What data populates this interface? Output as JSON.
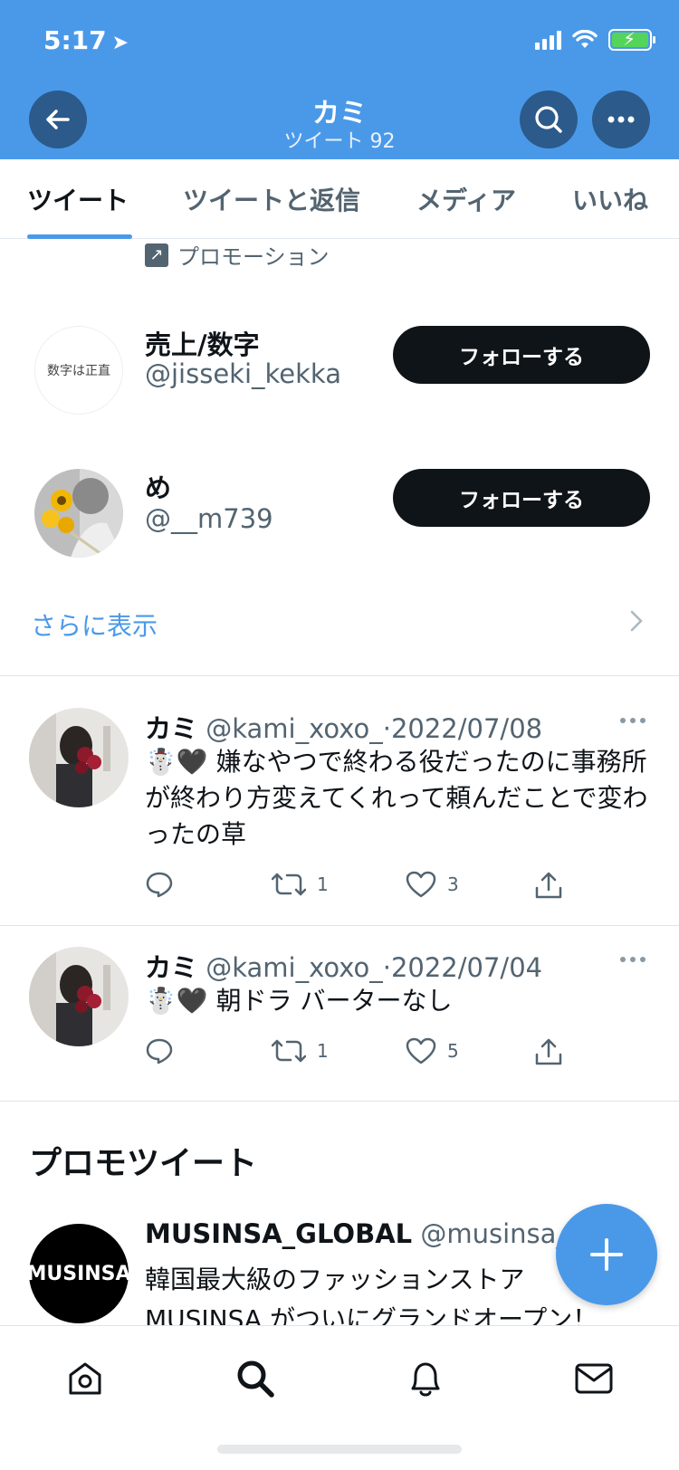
{
  "status_bar": {
    "time": "5:17"
  },
  "header": {
    "title": "カミ",
    "subtitle": "ツイート 92"
  },
  "tabs": [
    {
      "label": "ツイート",
      "active": true
    },
    {
      "label": "ツイートと返信",
      "active": false
    },
    {
      "label": "メディア",
      "active": false
    },
    {
      "label": "いいね",
      "active": false
    }
  ],
  "promotion_label": "プロモーション",
  "suggested_users": [
    {
      "name": "売上/数字",
      "handle": "@jisseki_kekka",
      "avatar_text": "数字は正直",
      "follow_label": "フォローする"
    },
    {
      "name": "め",
      "handle": "@__m739",
      "follow_label": "フォローする"
    }
  ],
  "show_more_label": "さらに表示",
  "tweets": [
    {
      "name": "カミ",
      "handle": "@kami_xoxo_",
      "date": "2022/07/08",
      "text": "嫌なやつで終わる役だったのに事務所が終わり方変えてくれって頼んだことで変わったの草",
      "retweets": "1",
      "likes": "3"
    },
    {
      "name": "カミ",
      "handle": "@kami_xoxo_",
      "date": "2022/07/04",
      "text": "朝ドラ バーターなし",
      "retweets": "1",
      "likes": "5"
    }
  ],
  "promo_section": {
    "heading": "プロモツイート",
    "name": "MUSINSA_GLOBAL",
    "handle": "@musinsa_",
    "avatar_text": "MUSINSA",
    "text_line1": "韓国最大級のファッションストア",
    "text_line2": "MUSINSA がついにグランドオープン！"
  },
  "colors": {
    "brand": "#4a99e9",
    "dark": "#0f1419",
    "muted": "#536471"
  }
}
